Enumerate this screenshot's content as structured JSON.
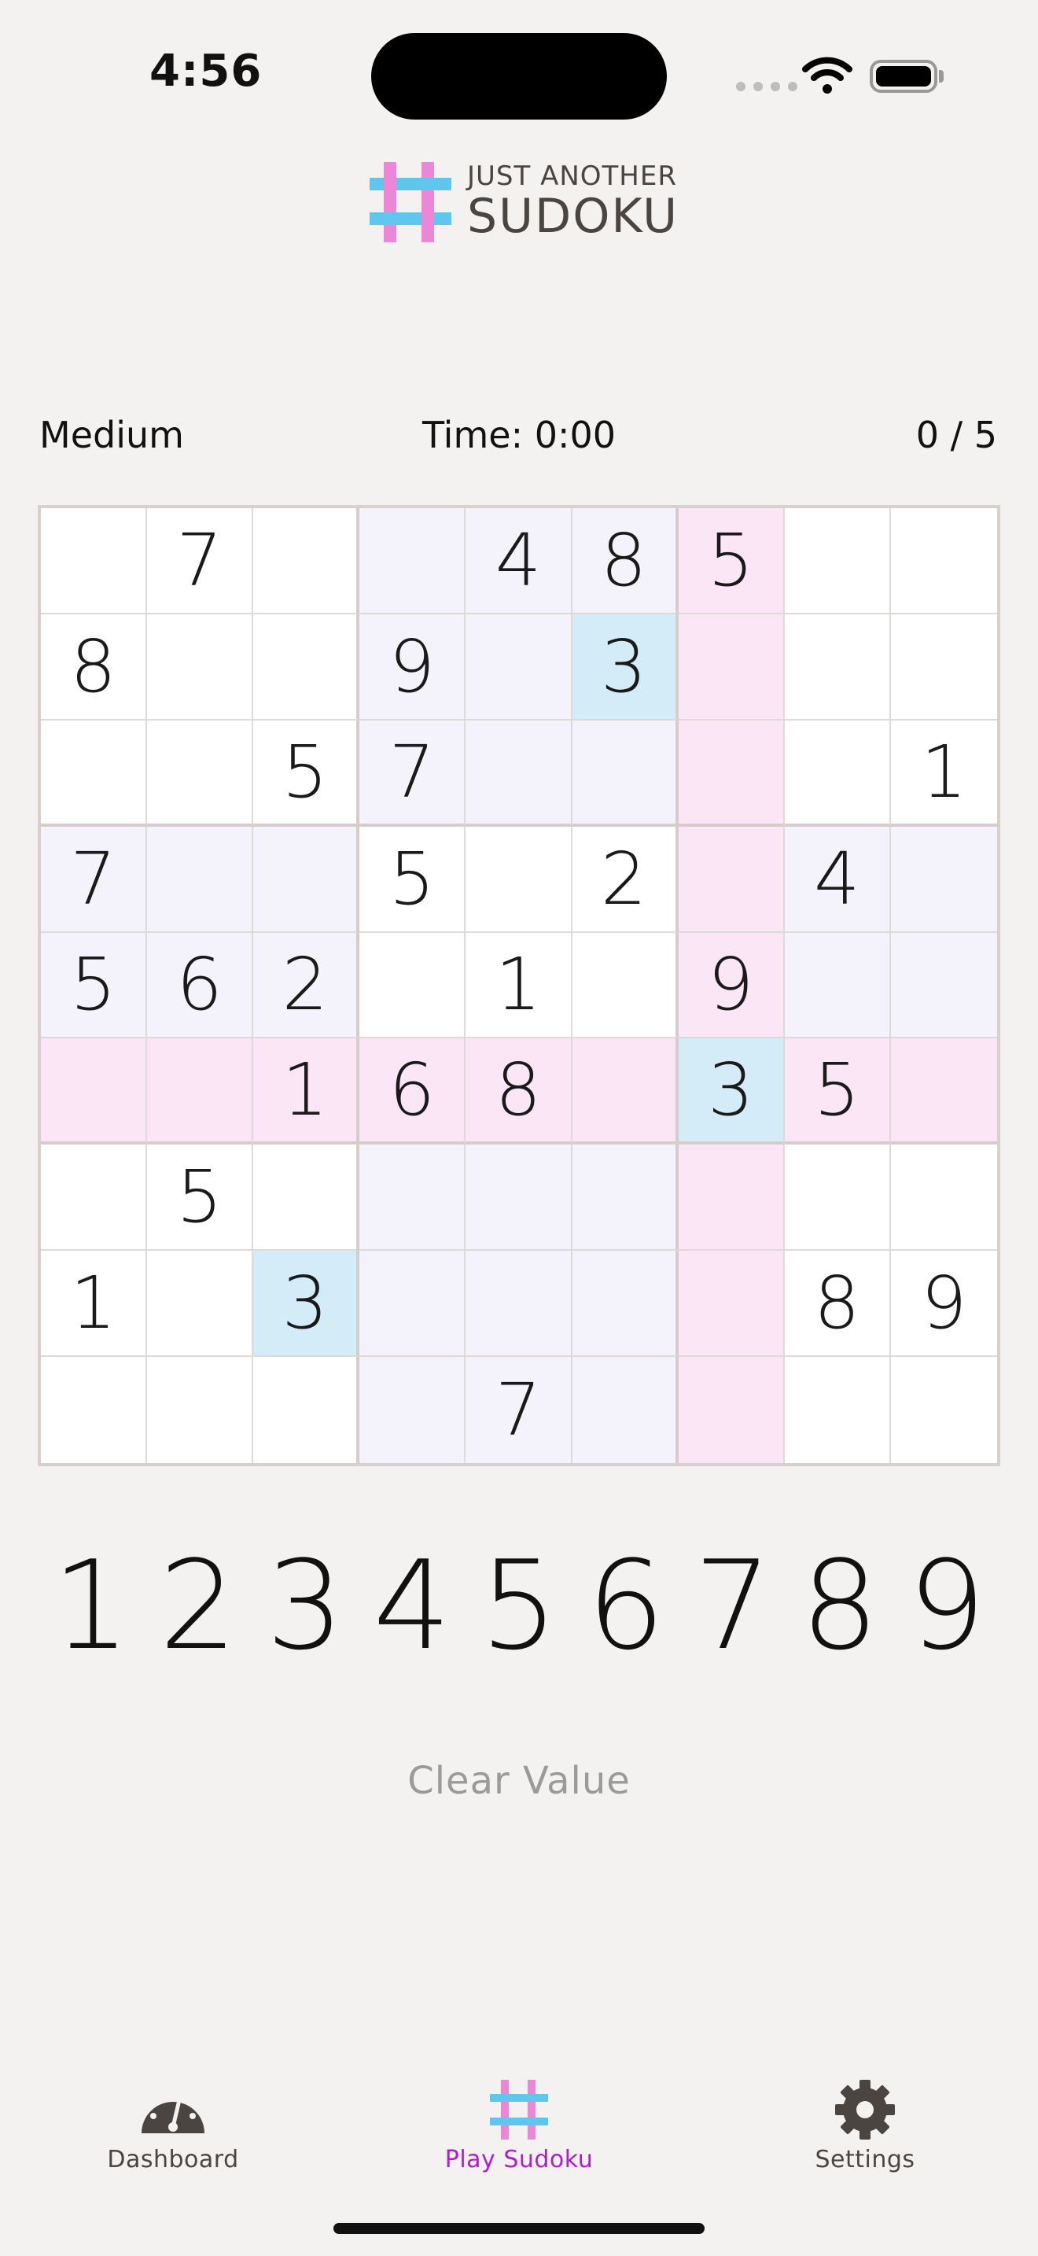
{
  "status_bar": {
    "time": "4:56"
  },
  "logo": {
    "line1": "JUST ANOTHER",
    "line2": "SUDOKU"
  },
  "game": {
    "difficulty": "Medium",
    "timer": "Time: 0:00",
    "mistakes": "0 / 5"
  },
  "grid": {
    "rows": [
      [
        "",
        "7",
        "",
        "",
        "4",
        "8",
        "5",
        "",
        ""
      ],
      [
        "8",
        "",
        "",
        "9",
        "",
        "3",
        "",
        "",
        ""
      ],
      [
        "",
        "",
        "5",
        "7",
        "",
        "",
        "",
        "",
        "1"
      ],
      [
        "7",
        "",
        "",
        "5",
        "",
        "2",
        "",
        "4",
        ""
      ],
      [
        "5",
        "6",
        "2",
        "",
        "1",
        "",
        "9",
        "",
        ""
      ],
      [
        "",
        "",
        "1",
        "6",
        "8",
        "",
        "3",
        "5",
        ""
      ],
      [
        "",
        "5",
        "",
        "",
        "",
        "",
        "",
        "",
        ""
      ],
      [
        "1",
        "",
        "3",
        "",
        "",
        "",
        "",
        "8",
        "9"
      ],
      [
        "",
        "",
        "",
        "",
        "7",
        "",
        "",
        "",
        ""
      ]
    ],
    "selected_row": 5,
    "selected_col": 6,
    "colors": {
      "box": "#f4f2fb",
      "line": "#fbe6f6",
      "same_value": "#d3ecf7"
    }
  },
  "number_pad": [
    "1",
    "2",
    "3",
    "4",
    "5",
    "6",
    "7",
    "8",
    "9"
  ],
  "clear_label": "Clear Value",
  "tabs": [
    {
      "label": "Dashboard",
      "icon": "gauge-icon"
    },
    {
      "label": "Play Sudoku",
      "icon": "hash-icon",
      "active": true
    },
    {
      "label": "Settings",
      "icon": "gear-icon"
    }
  ],
  "colors": {
    "accent": "#b11cd0",
    "logo_pink": "#ec86d6",
    "logo_blue": "#5fc6ee"
  }
}
